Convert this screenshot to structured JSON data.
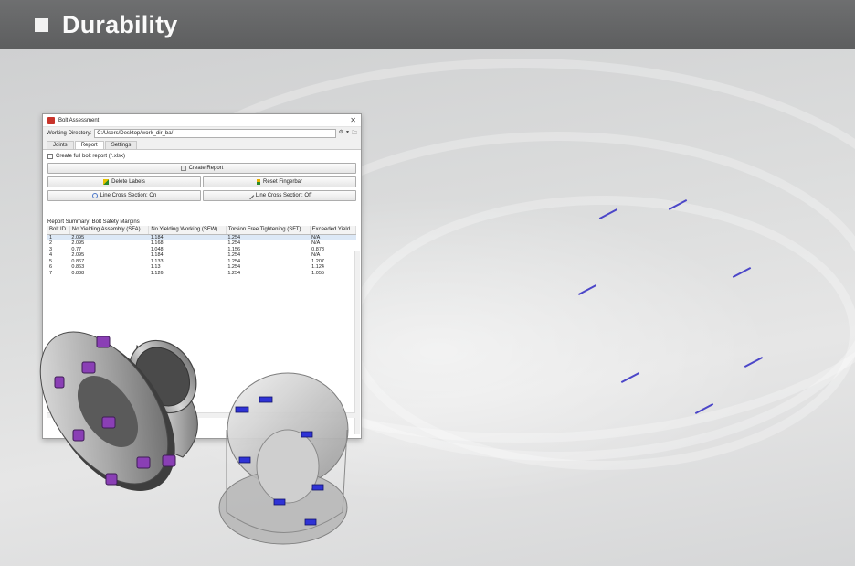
{
  "header": {
    "title": "Durability"
  },
  "dialog": {
    "title": "Bolt Assessment",
    "working_dir_label": "Working Directory:",
    "working_dir_value": "C:/Users/Desktop/work_dir_ba/",
    "tabs": [
      "Joints",
      "Report",
      "Settings"
    ],
    "active_tab": "Report",
    "create_full_report_label": "Create full bolt report (*.xlsx)",
    "buttons": {
      "create_report": "Create Report",
      "delete_labels": "Delete Labels",
      "reset_fingerbar": "Reset Fingerbar",
      "line_cross_on": "Line Cross Section: On",
      "line_cross_off": "Line Cross Section: Off"
    },
    "summary_title": "Report Summary: Bolt Safety Margins",
    "table": {
      "columns": [
        "Bolt ID",
        "No Yielding Assembly (SFA)",
        "No Yielding Working (SFW)",
        "Torsion Free Tightening (SFT)",
        "Exceeded Yield"
      ],
      "rows": [
        [
          "1",
          "2.095",
          "1.184",
          "1.254",
          "N/A"
        ],
        [
          "2",
          "2.095",
          "1.168",
          "1.254",
          "N/A"
        ],
        [
          "3",
          "0.77",
          "1.048",
          "1.156",
          "0.878"
        ],
        [
          "4",
          "2.095",
          "1.184",
          "1.254",
          "N/A"
        ],
        [
          "5",
          "0.867",
          "1.133",
          "1.254",
          "1.207"
        ],
        [
          "6",
          "0.863",
          "1.13",
          "1.254",
          "1.124"
        ],
        [
          "7",
          "0.838",
          "1.126",
          "1.254",
          "1.055"
        ]
      ]
    }
  },
  "colors": {
    "header_bg": "#626364",
    "dash": "#4b46c8",
    "bolt_purple": "#8a3fb5",
    "bolt_blue": "#2f33d6"
  }
}
